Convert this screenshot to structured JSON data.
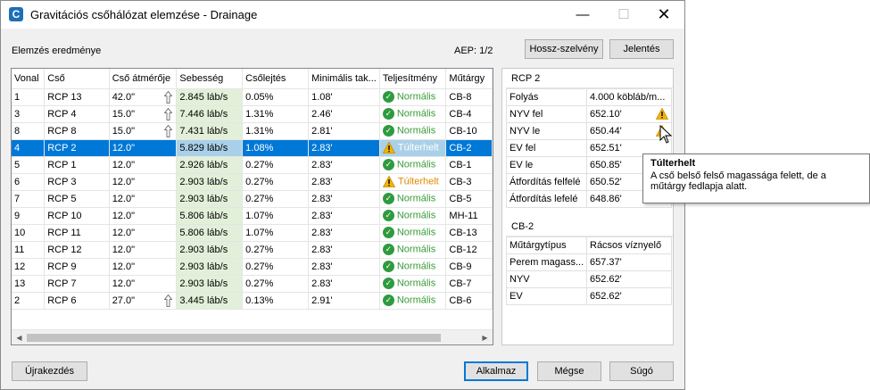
{
  "window": {
    "title": "Gravitációs csőhálózat elemzése - Drainage",
    "app_icon_letter": "C",
    "minimize": "—",
    "maximize": "☐",
    "close": "✕"
  },
  "header": {
    "section_label": "Elemzés eredménye",
    "aep": "AEP: 1/2",
    "profile_button": "Hossz-szelvény",
    "report_button": "Jelentés"
  },
  "table": {
    "columns": [
      "Vonal",
      "Cső",
      "Cső átmérője",
      "Sebesség",
      "Csőlejtés",
      "Minimális tak...",
      "Teljesítmény",
      "Műtárgy"
    ],
    "rows": [
      {
        "vonal": "1",
        "cso": "RCP 13",
        "atmero": "42.0\"",
        "arrow": true,
        "sebesseg": "2.845 láb/s",
        "lejtes": "0.05%",
        "takaras": "1.08'",
        "status": "ok",
        "teljesitmeny": "Normális",
        "mutargy": "CB-8"
      },
      {
        "vonal": "3",
        "cso": "RCP 4",
        "atmero": "15.0\"",
        "arrow": true,
        "sebesseg": "7.446 láb/s",
        "lejtes": "1.31%",
        "takaras": "2.46'",
        "status": "ok",
        "teljesitmeny": "Normális",
        "mutargy": "CB-4"
      },
      {
        "vonal": "8",
        "cso": "RCP 8",
        "atmero": "15.0\"",
        "arrow": true,
        "sebesseg": "7.431 láb/s",
        "lejtes": "1.31%",
        "takaras": "2.81'",
        "status": "ok",
        "teljesitmeny": "Normális",
        "mutargy": "CB-10"
      },
      {
        "vonal": "4",
        "cso": "RCP 2",
        "atmero": "12.0\"",
        "arrow": false,
        "sebesseg": "5.829 láb/s",
        "lejtes": "1.08%",
        "takaras": "2.83'",
        "status": "warn",
        "teljesitmeny": "Túlterhelt",
        "mutargy": "CB-2",
        "selected": true
      },
      {
        "vonal": "5",
        "cso": "RCP 1",
        "atmero": "12.0\"",
        "arrow": false,
        "sebesseg": "2.926 láb/s",
        "lejtes": "0.27%",
        "takaras": "2.83'",
        "status": "ok",
        "teljesitmeny": "Normális",
        "mutargy": "CB-1"
      },
      {
        "vonal": "6",
        "cso": "RCP 3",
        "atmero": "12.0\"",
        "arrow": false,
        "sebesseg": "2.903 láb/s",
        "lejtes": "0.27%",
        "takaras": "2.83'",
        "status": "warn",
        "teljesitmeny": "Túlterhelt",
        "mutargy": "CB-3"
      },
      {
        "vonal": "7",
        "cso": "RCP 5",
        "atmero": "12.0\"",
        "arrow": false,
        "sebesseg": "2.903 láb/s",
        "lejtes": "0.27%",
        "takaras": "2.83'",
        "status": "ok",
        "teljesitmeny": "Normális",
        "mutargy": "CB-5"
      },
      {
        "vonal": "9",
        "cso": "RCP 10",
        "atmero": "12.0\"",
        "arrow": false,
        "sebesseg": "5.806 láb/s",
        "lejtes": "1.07%",
        "takaras": "2.83'",
        "status": "ok",
        "teljesitmeny": "Normális",
        "mutargy": "MH-11"
      },
      {
        "vonal": "10",
        "cso": "RCP 11",
        "atmero": "12.0\"",
        "arrow": false,
        "sebesseg": "5.806 láb/s",
        "lejtes": "1.07%",
        "takaras": "2.83'",
        "status": "ok",
        "teljesitmeny": "Normális",
        "mutargy": "CB-13"
      },
      {
        "vonal": "11",
        "cso": "RCP 12",
        "atmero": "12.0\"",
        "arrow": false,
        "sebesseg": "2.903 láb/s",
        "lejtes": "0.27%",
        "takaras": "2.83'",
        "status": "ok",
        "teljesitmeny": "Normális",
        "mutargy": "CB-12"
      },
      {
        "vonal": "12",
        "cso": "RCP 9",
        "atmero": "12.0\"",
        "arrow": false,
        "sebesseg": "2.903 láb/s",
        "lejtes": "0.27%",
        "takaras": "2.83'",
        "status": "ok",
        "teljesitmeny": "Normális",
        "mutargy": "CB-9"
      },
      {
        "vonal": "13",
        "cso": "RCP 7",
        "atmero": "12.0\"",
        "arrow": false,
        "sebesseg": "2.903 láb/s",
        "lejtes": "0.27%",
        "takaras": "2.83'",
        "status": "ok",
        "teljesitmeny": "Normális",
        "mutargy": "CB-7"
      },
      {
        "vonal": "2",
        "cso": "RCP 6",
        "atmero": "27.0\"",
        "arrow": true,
        "sebesseg": "3.445 láb/s",
        "lejtes": "0.13%",
        "takaras": "2.91'",
        "status": "ok",
        "teljesitmeny": "Normális",
        "mutargy": "CB-6"
      }
    ]
  },
  "properties": {
    "pipe_group": {
      "title": "RCP 2",
      "rows": [
        {
          "label": "Folyás",
          "value": "4.000 köbláb/m...",
          "warn": false
        },
        {
          "label": "NYV fel",
          "value": "652.10'",
          "warn": true
        },
        {
          "label": "NYV le",
          "value": "650.44'",
          "warn": true
        },
        {
          "label": "EV fel",
          "value": "652.51'",
          "warn": false
        },
        {
          "label": "EV le",
          "value": "650.85'",
          "warn": false
        },
        {
          "label": "Átfordítás felfelé",
          "value": "650.52'",
          "warn": false
        },
        {
          "label": "Átfordítás lefelé",
          "value": "648.86'",
          "warn": false
        }
      ]
    },
    "structure_group": {
      "title": "CB-2",
      "rows": [
        {
          "label": "Műtárgytípus",
          "value": "Rácsos víznyelő"
        },
        {
          "label": "Perem magass...",
          "value": "657.37'"
        },
        {
          "label": "NYV",
          "value": "652.62'"
        },
        {
          "label": "EV",
          "value": "652.62'"
        }
      ]
    }
  },
  "tooltip": {
    "title": "Túlterhelt",
    "text": "A cső belső felső magassága felett, de a műtárgy fedlapja alatt."
  },
  "footer": {
    "reset_button": "Újrakezdés",
    "apply_button": "Alkalmaz",
    "cancel_button": "Mégse",
    "help_button": "Súgó"
  },
  "colors": {
    "selection": "#0078d7",
    "velocity_cell": "#e2f0d9",
    "ok_green": "#2e9b3f",
    "warn_orange": "#e08a00"
  }
}
